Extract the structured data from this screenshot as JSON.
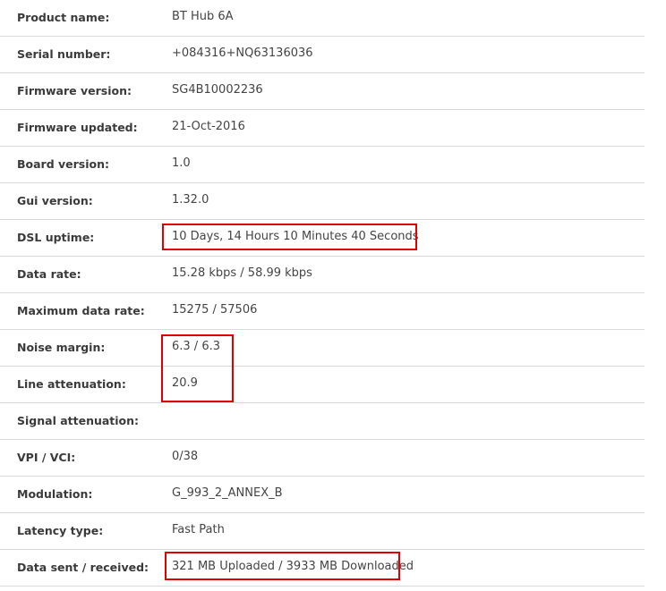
{
  "rows": [
    {
      "label": "Product name:",
      "value": "BT Hub 6A"
    },
    {
      "label": "Serial number:",
      "value": "+084316+NQ63136036"
    },
    {
      "label": "Firmware version:",
      "value": "SG4B10002236"
    },
    {
      "label": "Firmware updated:",
      "value": "21-Oct-2016"
    },
    {
      "label": "Board version:",
      "value": "1.0"
    },
    {
      "label": "Gui version:",
      "value": "1.32.0"
    },
    {
      "label": "DSL uptime:",
      "value": "10 Days, 14 Hours 10 Minutes 40 Seconds"
    },
    {
      "label": "Data rate:",
      "value": "15.28 kbps / 58.99 kbps"
    },
    {
      "label": "Maximum data rate:",
      "value": "15275 / 57506"
    },
    {
      "label": "Noise margin:",
      "value": "6.3 / 6.3"
    },
    {
      "label": "Line attenuation:",
      "value": "20.9"
    },
    {
      "label": "Signal attenuation:",
      "value": ""
    },
    {
      "label": "VPI / VCI:",
      "value": "0/38"
    },
    {
      "label": "Modulation:",
      "value": "G_993_2_ANNEX_B"
    },
    {
      "label": "Latency type:",
      "value": "Fast Path"
    },
    {
      "label": "Data sent / received:",
      "value": "321 MB Uploaded / 3933 MB Downloaded"
    }
  ],
  "highlight_color": "#e00000"
}
